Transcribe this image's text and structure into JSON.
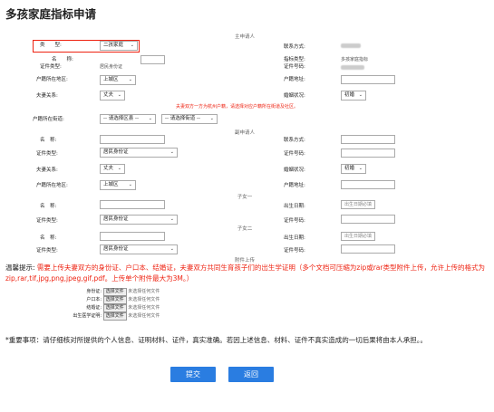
{
  "page": {
    "title": "多孩家庭指标申请"
  },
  "main_applicant": {
    "section": "主申请人",
    "type_label": "类　　型:",
    "type_value": "二孩家庭",
    "name_label": "名　　称:",
    "id_type_label": "证件类型:",
    "id_type_value": "居民身份证",
    "region_label": "户籍所在地区:",
    "region_value": "上城区",
    "relation_label": "夫妻关系:",
    "relation_value": "丈夫",
    "contact_label": "联系方式:",
    "indicator_label": "指标类型:",
    "indicator_value": "多孩家庭指标",
    "id_no_label": "证件号码:",
    "address_label": "户籍地址:",
    "marital_label": "婚姻状况:",
    "marital_value": "初婚",
    "street_warning": "夫妻双方一方为杭州户籍，请选择对应户籍所在街道及社区。",
    "street_label": "户籍所在街道:",
    "street_select": "-- 请选择区县 --",
    "community_select": "-- 请选择街道 --"
  },
  "secondary_applicant": {
    "section": "副申请人",
    "name_label": "名　称:",
    "id_type_label": "证件类型:",
    "id_type_value": "居民身份证",
    "relation_label": "夫妻关系:",
    "relation_value": "丈夫",
    "region_label": "户籍所在地区:",
    "region_value": "上城区",
    "contact_label": "联系方式:",
    "id_no_label": "证件号码:",
    "marital_label": "婚姻状况:",
    "marital_value": "初婚",
    "address_label": "户籍地址:"
  },
  "child1": {
    "section": "子女一",
    "name_label": "名　称:",
    "id_type_label": "证件类型:",
    "id_type_value": "居民身份证",
    "birth_label": "出生日期:",
    "birth_placeholder": "出生日期必填",
    "id_no_label": "证件号码:"
  },
  "child2": {
    "section": "子女二",
    "name_label": "名　称:",
    "id_type_label": "证件类型:",
    "id_type_value": "居民身份证",
    "birth_label": "出生日期:",
    "birth_placeholder": "出生日期必填",
    "id_no_label": "证件号码:"
  },
  "attachments": {
    "section": "附件上传",
    "notice_prefix": "温馨提示:",
    "notice_text": "需要上传夫妻双方的身份证、户口本、结婚证，夫妻双方共同生育孩子们的出生学证明（多个文档可压缩为zip或rar类型附件上传，允许上传的格式为zip,rar,tif,jpg,png,jpeg,gif,pdf。上传单个附件最大为3M。）",
    "files": [
      {
        "label": "身份证:",
        "button": "选择文件",
        "status": "未选择任何文件"
      },
      {
        "label": "户口本:",
        "button": "选择文件",
        "status": "未选择任何文件"
      },
      {
        "label": "结婚证:",
        "button": "选择文件",
        "status": "未选择任何文件"
      },
      {
        "label": "出生医学证明:",
        "button": "选择文件",
        "status": "未选择任何文件"
      }
    ]
  },
  "important": {
    "text": "*重要事项：请仔细核对所提供的个人信息、证明材料、证件，真实准确。若因上述信息、材料、证件不真实造成的一切后果将由本人承担。。"
  },
  "actions": {
    "submit": "提交",
    "back": "返回"
  },
  "colors": {
    "accent": "#2a7de1",
    "warning": "#e21111"
  }
}
